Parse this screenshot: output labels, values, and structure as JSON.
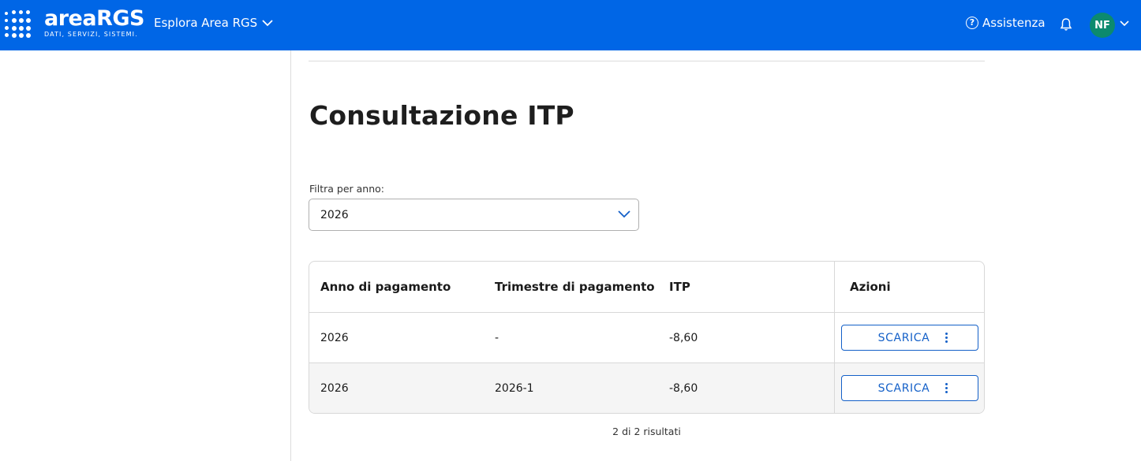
{
  "header": {
    "logo_word": "areaRGS",
    "logo_tagline": "DATI, SERVIZI, SISTEMI.",
    "explore_label": "Esplora Area RGS",
    "help_label": "Assistenza",
    "avatar_initials": "NF",
    "bg_color": "#0066e6",
    "avatar_color": "#0c8a6e"
  },
  "page": {
    "title": "Consultazione ITP"
  },
  "filter": {
    "label": "Filtra per anno:",
    "selected": "2026"
  },
  "table": {
    "headers": [
      "Anno di pagamento",
      "Trimestre di pagamento",
      "ITP",
      "Azioni"
    ],
    "rows": [
      {
        "anno": "2026",
        "trimestre": "-",
        "itp": "-8,60",
        "action": "SCARICA"
      },
      {
        "anno": "2026",
        "trimestre": "2026-1",
        "itp": "-8,60",
        "action": "SCARICA"
      }
    ]
  },
  "footer": {
    "results_text": "2 di 2 risultati"
  }
}
